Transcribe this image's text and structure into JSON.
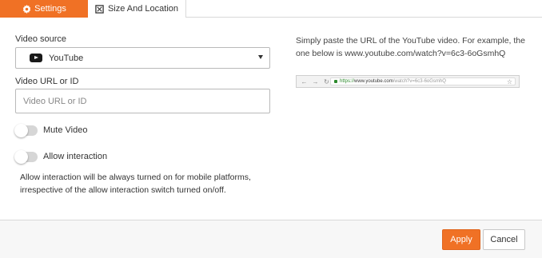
{
  "tabs": [
    {
      "label": "Settings",
      "icon": "gear-icon",
      "active": true
    },
    {
      "label": "Size And Location",
      "icon": "resize-icon",
      "active": false
    }
  ],
  "video_source": {
    "label": "Video source",
    "selected": "YouTube",
    "icon": "youtube-icon"
  },
  "video_url": {
    "label": "Video URL or ID",
    "value": "",
    "placeholder": "Video URL or ID"
  },
  "toggles": {
    "mute": {
      "label": "Mute Video",
      "on": false
    },
    "interaction": {
      "label": "Allow interaction",
      "on": false
    }
  },
  "note": "Allow interaction will be always turned on for mobile platforms, irrespective of the allow interaction switch turned on/off.",
  "help": {
    "text": "Simply paste the URL of the YouTube video. For example, the one below is www.youtube.com/watch?v=6c3-6oGsmhQ",
    "example_url_secure": "https://",
    "example_url_host": "www.youtube.com",
    "example_url_path": "/watch?v=6c3-6oGsmhQ"
  },
  "footer": {
    "apply_label": "Apply",
    "cancel_label": "Cancel"
  },
  "colors": {
    "accent": "#f07125",
    "toggle_off": "#d6d6d6",
    "secure_green": "#2d8a2d"
  }
}
